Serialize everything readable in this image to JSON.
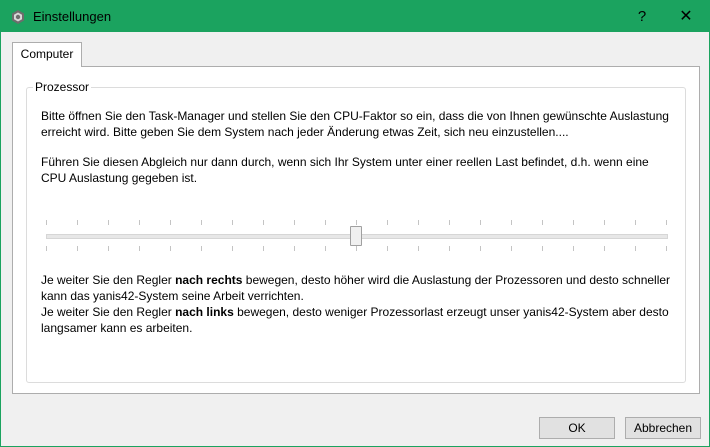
{
  "window": {
    "title": "Einstellungen",
    "app_icon": "gear-icon",
    "help_label": "?",
    "close_label": "✕",
    "accent_color": "#1ba35f"
  },
  "tabs": [
    {
      "label": "Computer",
      "active": true
    }
  ],
  "processor_group": {
    "label": "Prozessor",
    "paragraph_1": "Bitte öffnen Sie den Task-Manager und stellen Sie den CPU-Faktor so ein, dass die von Ihnen gewünschte Auslastung erreicht wird. Bitte geben Sie dem System nach jeder Änderung etwas Zeit, sich neu einzustellen....",
    "paragraph_2": "Führen Sie diesen Abgleich nur dann durch, wenn sich Ihr System unter einer reellen Last befindet, d.h. wenn eine CPU Auslastung gegeben ist.",
    "slider": {
      "position_fraction": 0.5,
      "tick_count": 20
    },
    "hint_right_pre": "Je weiter Sie den Regler ",
    "hint_right_bold": "nach rechts",
    "hint_right_post": " bewegen, desto höher wird die Auslastung der Prozessoren und desto schneller kann das yanis42-System seine Arbeit verrichten.",
    "hint_left_pre": "Je weiter Sie den Regler ",
    "hint_left_bold": "nach links",
    "hint_left_post": " bewegen, desto weniger Prozessorlast erzeugt unser yanis42-System aber desto langsamer kann es arbeiten."
  },
  "buttons": {
    "ok": "OK",
    "cancel": "Abbrechen"
  }
}
